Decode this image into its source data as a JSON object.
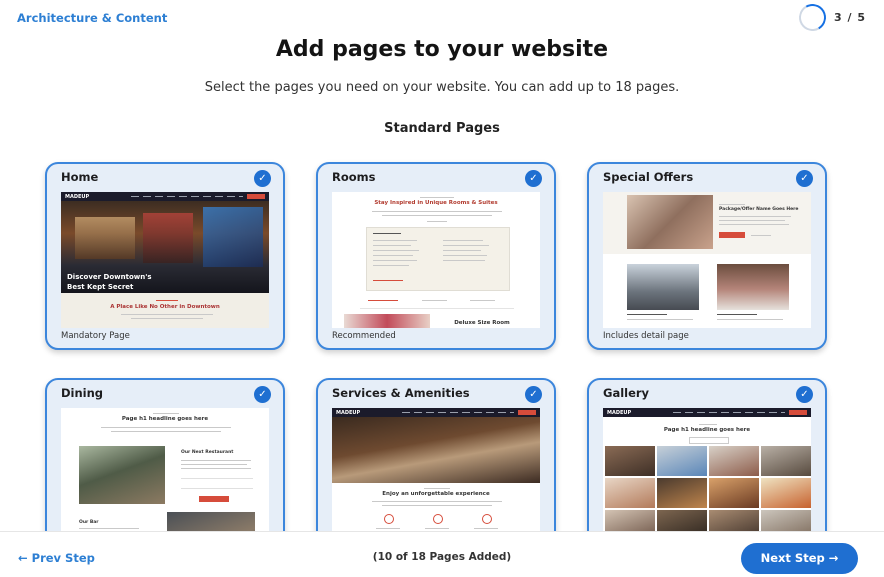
{
  "header": {
    "section_link": "Architecture & Content",
    "step": "3 / 5"
  },
  "main": {
    "title": "Add pages to your website",
    "subtitle": "Select the pages you need on your website. You can add up to 18 pages.",
    "section_title": "Standard Pages"
  },
  "cards": [
    {
      "title": "Home",
      "note": "Mandatory Page",
      "checked": true,
      "preview": {
        "logo": "MADEUP",
        "hero_line1": "Discover Downtown's",
        "hero_line2": "Best Kept Secret",
        "tagline": "A Place Like No Other in Downtown"
      }
    },
    {
      "title": "Rooms",
      "note": "Recommended",
      "checked": true,
      "preview": {
        "heading": "Stay Inspired in Unique Rooms & Suites",
        "subheading": "Deluxe Size Room"
      }
    },
    {
      "title": "Special Offers",
      "note": "Includes detail page",
      "checked": true,
      "preview": {
        "offer_title": "Package/Offer Name Goes Here"
      }
    },
    {
      "title": "Dining",
      "note": "",
      "checked": true,
      "preview": {
        "heading": "Page h1 headline goes here",
        "restaurant": "Our Next Restaurant",
        "bar": "Our Bar"
      }
    },
    {
      "title": "Services & Amenities",
      "note": "",
      "checked": true,
      "preview": {
        "logo": "MADEUP",
        "heading": "Enjoy an unforgettable experience"
      }
    },
    {
      "title": "Gallery",
      "note": "",
      "checked": true,
      "preview": {
        "logo": "MADEUP",
        "heading": "Page h1 headline goes here"
      }
    }
  ],
  "footer": {
    "prev_label": "← Prev Step",
    "pages_count": "(10 of 18 Pages Added)",
    "next_label": "Next Step →"
  },
  "colors": {
    "accent": "#1f6fd1",
    "link": "#2d7fd3",
    "card_border": "#3c86dc",
    "card_bg": "#e6eef8"
  },
  "icons": [
    "check-icon",
    "progress-ring-icon"
  ]
}
